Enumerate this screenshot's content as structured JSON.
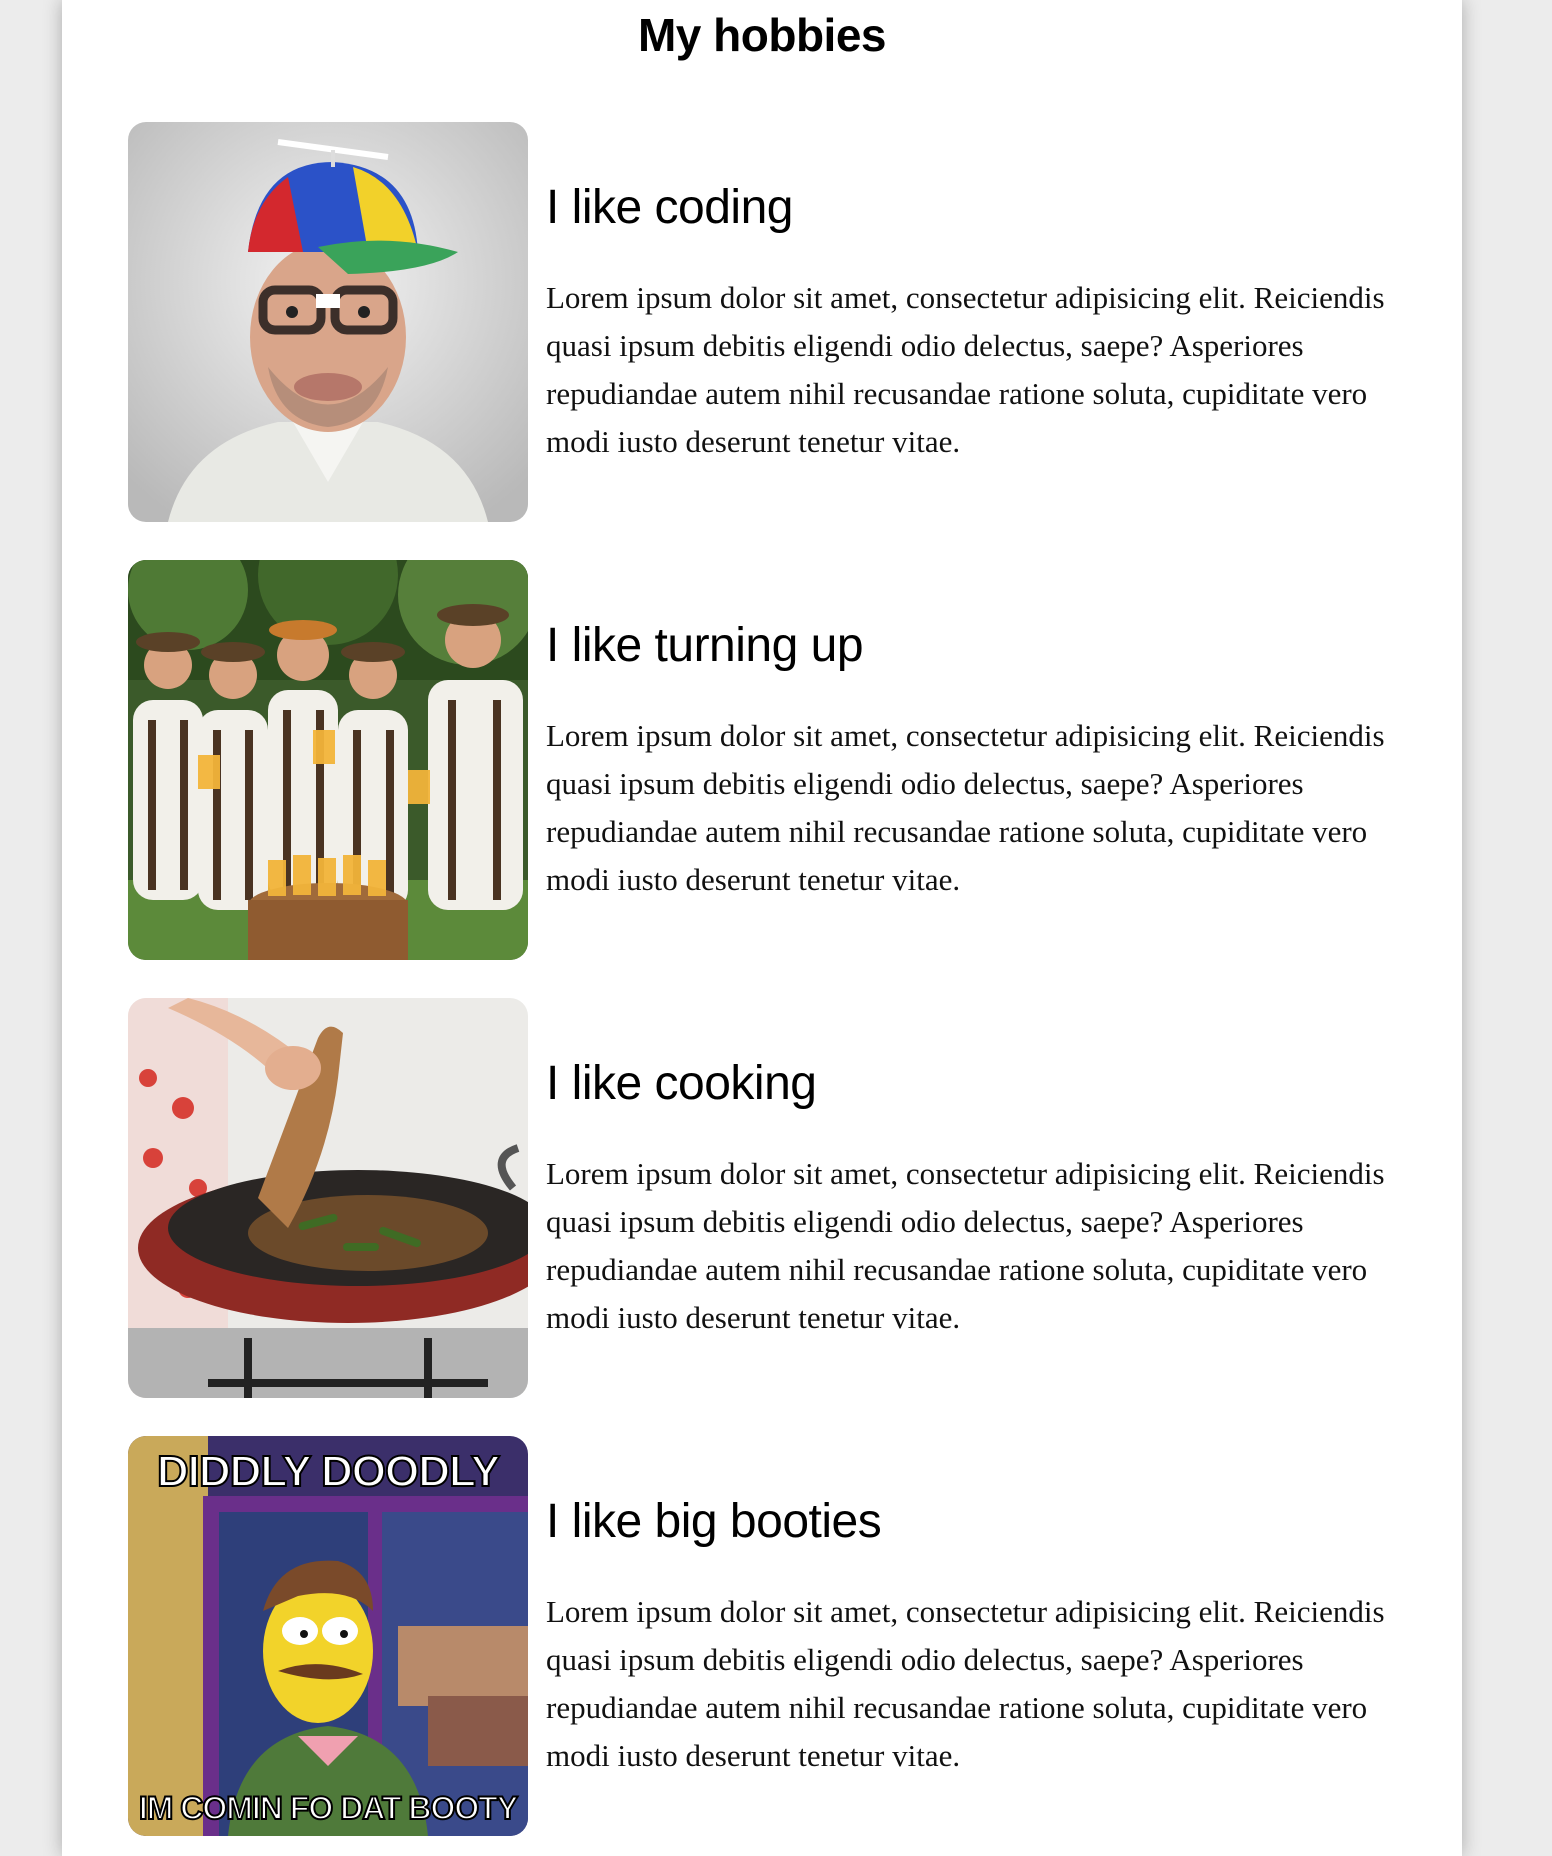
{
  "page": {
    "title": "My hobbies"
  },
  "hobbies": [
    {
      "title": "I like coding",
      "text": "Lorem ipsum dolor sit amet, consectetur adipisicing elit. Reiciendis quasi ipsum debitis eligendi odio delectus, saepe? Asperiores repudiandae autem nihil recusandae ratione soluta, cupiditate vero modi iusto deserunt tenetur vitae."
    },
    {
      "title": "I like turning up",
      "text": "Lorem ipsum dolor sit amet, consectetur adipisicing elit. Reiciendis quasi ipsum debitis eligendi odio delectus, saepe? Asperiores repudiandae autem nihil recusandae ratione soluta, cupiditate vero modi iusto deserunt tenetur vitae."
    },
    {
      "title": "I like cooking",
      "text": "Lorem ipsum dolor sit amet, consectetur adipisicing elit. Reiciendis quasi ipsum debitis eligendi odio delectus, saepe? Asperiores repudiandae autem nihil recusandae ratione soluta, cupiditate vero modi iusto deserunt tenetur vitae."
    },
    {
      "title": "I like big booties",
      "text": "Lorem ipsum dolor sit amet, consectetur adipisicing elit. Reiciendis quasi ipsum debitis eligendi odio delectus, saepe? Asperiores repudiandae autem nihil recusandae ratione soluta, cupiditate vero modi iusto deserunt tenetur vitae.",
      "meme_top": "DIDDLY DOODLY",
      "meme_bottom": "IM COMIN FO DAT BOOTY"
    }
  ]
}
